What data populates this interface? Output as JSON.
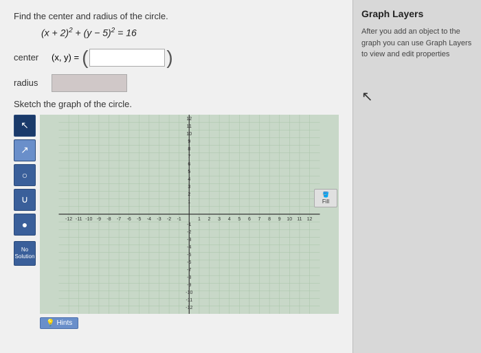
{
  "problem": {
    "instruction": "Find the center and radius of the circle.",
    "equation": "(x + 2)² + (y − 5)² = 16",
    "center_label": "center",
    "center_prefix": "(x, y) = (",
    "center_suffix": ")",
    "center_value": "",
    "center_placeholder": "",
    "radius_label": "radius",
    "radius_value": "",
    "sketch_label": "Sketch the graph of the circle."
  },
  "toolbar": {
    "tools": [
      {
        "name": "pointer",
        "symbol": "↖"
      },
      {
        "name": "arrow",
        "symbol": "↗"
      },
      {
        "name": "circle",
        "symbol": "○"
      },
      {
        "name": "curve",
        "symbol": "∪"
      },
      {
        "name": "dot",
        "symbol": "●"
      }
    ],
    "no_solution_label": "No\nSolution"
  },
  "fill_button": {
    "icon": "🪣",
    "label": "Fill"
  },
  "hint_button": {
    "label": "Hints"
  },
  "graph_layers": {
    "title": "Graph Layers",
    "description": "After you add an object to the graph you can use Graph Layers to view and edit properties"
  },
  "colors": {
    "toolbar_bg": "#3a5f9a",
    "graph_bg": "#c8d8c8",
    "right_panel_bg": "#d8d8d8"
  }
}
